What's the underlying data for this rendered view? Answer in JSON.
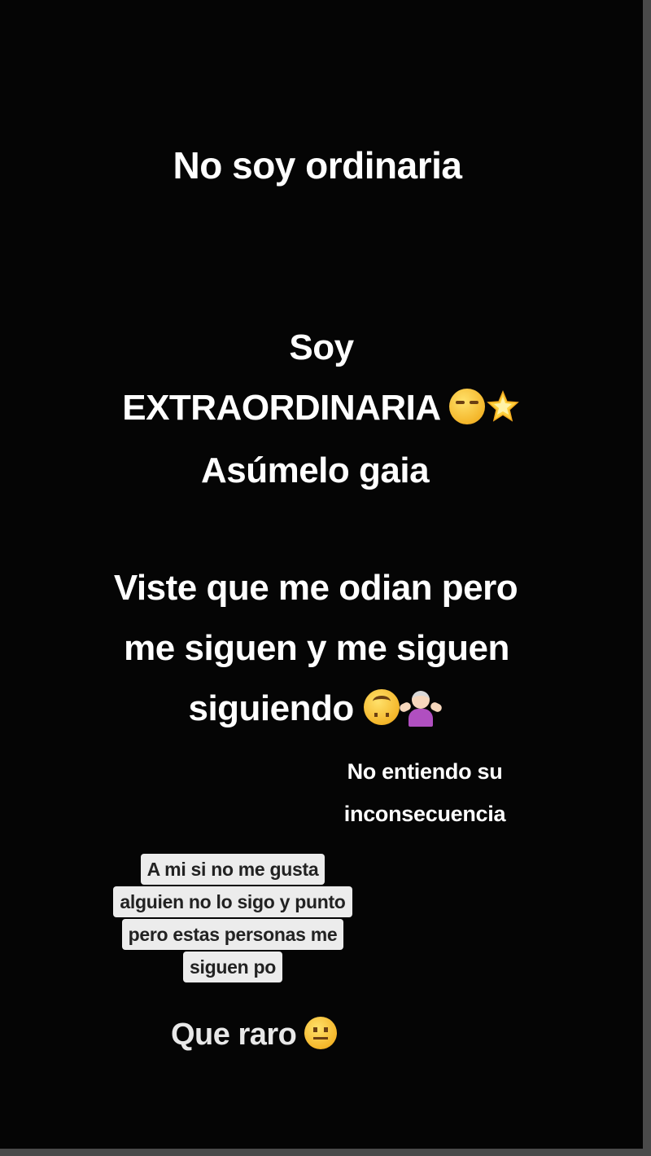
{
  "story": {
    "line1": "No soy ordinaria",
    "line2": "Soy",
    "line3": "EXTRAORDINARIA",
    "line4": "Asúmelo gaia",
    "line5": "Viste que me odian pero",
    "line6": "me siguen y me siguen",
    "line7": "siguiendo",
    "caption_line1": "No entiendo su",
    "caption_line2": "inconsecuencia",
    "boxed_lines": [
      "A mi si no me gusta",
      "alguien no lo sigo y punto",
      "pero estas personas me",
      "siguen po"
    ],
    "closing": "Que raro",
    "emojis": [
      "smirk-face",
      "glowing-star",
      "upside-down-face",
      "person-shrugging",
      "neutral-face"
    ],
    "colors": {
      "background": "#050505",
      "text": "#ffffff",
      "box_background": "#ececec",
      "box_text": "#222222"
    }
  }
}
